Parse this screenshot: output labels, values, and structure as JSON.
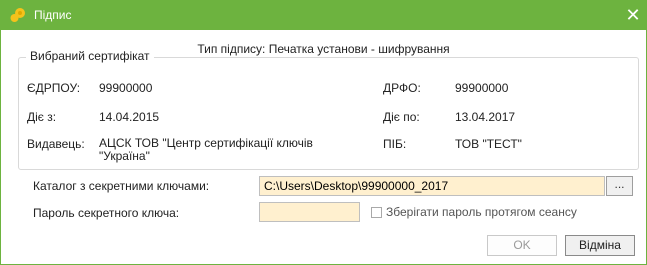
{
  "window": {
    "title": "Підпис",
    "close_symbol": "✕"
  },
  "signature_type": "Тип підпису: Печатка установи - шифрування",
  "certificate": {
    "group_title": "Вибраний сертифікат",
    "edrpou_label": "ЄДРПОУ:",
    "edrpou_value": "99900000",
    "drfo_label": "ДРФО:",
    "drfo_value": "99900000",
    "valid_from_label": "Діє з:",
    "valid_from_value": "14.04.2015",
    "valid_to_label": "Діє по:",
    "valid_to_value": "13.04.2017",
    "issuer_label": "Видавець:",
    "issuer_value": "АЦСК ТОВ \"Центр сертифікації ключів \"Україна\"",
    "pib_label": "ПІБ:",
    "pib_value": "ТОВ \"ТЕСТ\""
  },
  "keys_dir": {
    "label": "Каталог з секретними ключами:",
    "value": "C:\\Users\\Desktop\\99900000_2017",
    "browse_label": "..."
  },
  "password": {
    "label": "Пароль секретного ключа:",
    "value": "",
    "remember_label": "Зберігати пароль протягом сеансу",
    "remember_checked": false
  },
  "buttons": {
    "ok": "OK",
    "cancel": "Відміна"
  },
  "colors": {
    "titlebar": "#6db33f",
    "input_bg": "#fff0cf",
    "app_icon": "#f5c21b"
  },
  "icons": {
    "app": "app-logo-icon",
    "close": "close-icon"
  }
}
